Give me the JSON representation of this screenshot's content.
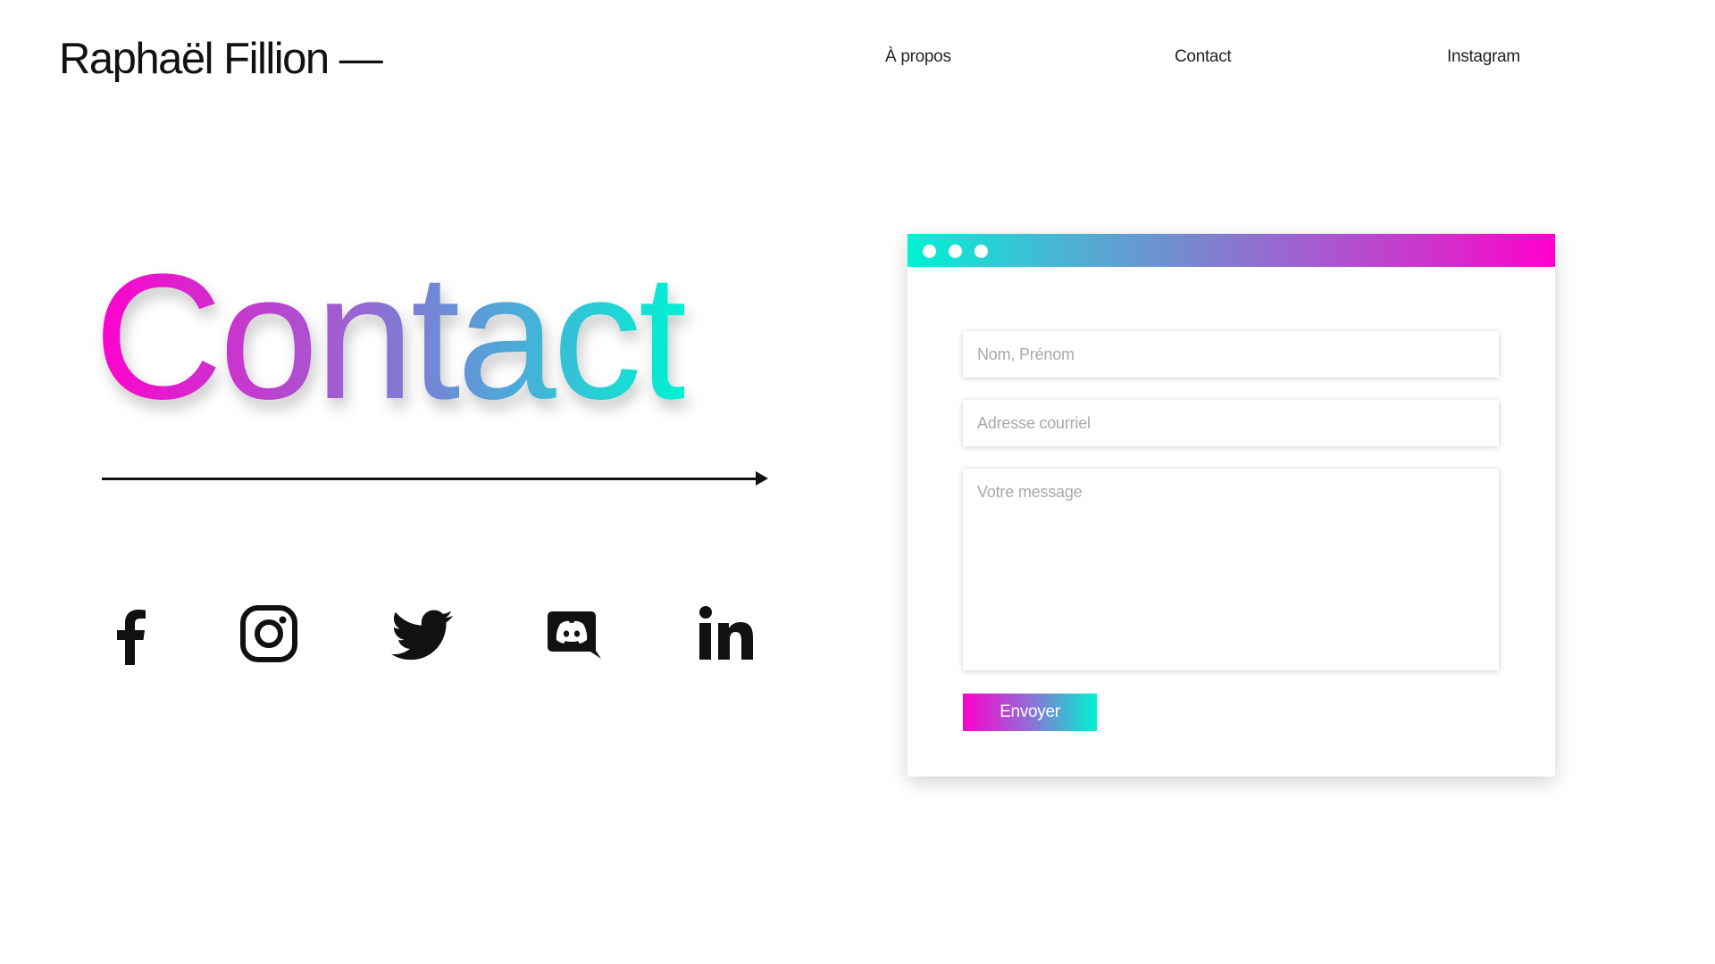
{
  "header": {
    "brand": "Raphaël Fillion —",
    "nav": [
      {
        "label": "À propos"
      },
      {
        "label": "Contact"
      },
      {
        "label": "Instagram"
      }
    ]
  },
  "hero": {
    "title": "Contact",
    "gradient_colors": [
      "#ff00cc",
      "#a855d0",
      "#4fa8d8",
      "#00f2d2"
    ]
  },
  "social": [
    {
      "icon": "facebook-icon"
    },
    {
      "icon": "instagram-icon"
    },
    {
      "icon": "twitter-icon"
    },
    {
      "icon": "discord-icon"
    },
    {
      "icon": "linkedin-icon"
    }
  ],
  "form": {
    "window_bar_gradient": [
      "#00f2d2",
      "#ff00cc"
    ],
    "name_placeholder": "Nom, Prénom",
    "email_placeholder": "Adresse courriel",
    "message_placeholder": "Votre message",
    "submit_label": "Envoyer",
    "submit_gradient": [
      "#ff00cc",
      "#00f2d2"
    ]
  }
}
